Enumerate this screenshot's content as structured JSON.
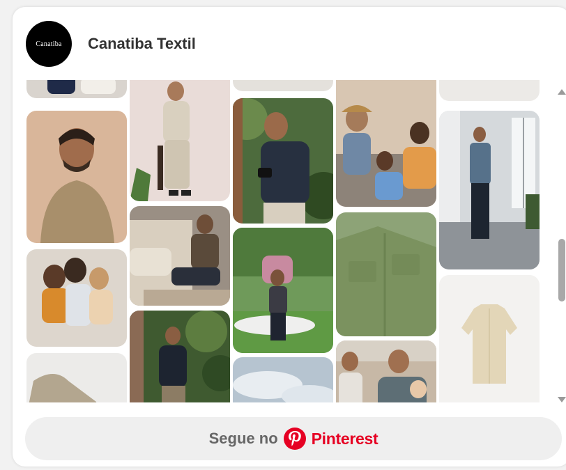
{
  "profile": {
    "name": "Canatiba Textil",
    "avatar_text": "Canatiba"
  },
  "board": {
    "pins": [
      {
        "name": "pin-man-partial-top",
        "bg": "#d9d4ce",
        "fg": "#1f2a48"
      },
      {
        "name": "pin-man-beige-shirt",
        "bg": "#d9b69a",
        "fg": "#a88f6b"
      },
      {
        "name": "pin-family-on-floor",
        "bg": "#ddd6cd",
        "fg": "#d88a2c"
      },
      {
        "name": "pin-shirt-partial",
        "bg": "#ecebe9",
        "fg": "#b3a68f"
      },
      {
        "name": "pin-man-chair-white-outfit",
        "bg": "#e9dcd8",
        "fg": "#d9d0bf"
      },
      {
        "name": "pin-man-on-sofa",
        "bg": "#9a8f84",
        "fg": "#2a2f3a"
      },
      {
        "name": "pin-man-in-forest",
        "bg": "#3f5a30",
        "fg": "#1d2430"
      },
      {
        "name": "pin-top-sliver-col3",
        "bg": "#e4e1dc",
        "fg": "#c9c4bb"
      },
      {
        "name": "pin-man-with-camera",
        "bg": "#4d6b3d",
        "fg": "#273040"
      },
      {
        "name": "pin-man-lifting-child-park",
        "bg": "#6f9a5a",
        "fg": "#3b3b44"
      },
      {
        "name": "pin-sky-partial",
        "bg": "#b6c4d0",
        "fg": "#e8edf1"
      },
      {
        "name": "pin-family-on-sofa",
        "bg": "#d8c6b2",
        "fg": "#6f88a5"
      },
      {
        "name": "pin-green-shirt-folded",
        "bg": "#8da377",
        "fg": "#7b925f"
      },
      {
        "name": "pin-man-with-children",
        "bg": "#c7b8a6",
        "fg": "#5d6e75"
      },
      {
        "name": "pin-top-sliver-col5",
        "bg": "#eceae7",
        "fg": "#d9d6d2"
      },
      {
        "name": "pin-man-loft-standing",
        "bg": "#d5d9dc",
        "fg": "#56718a"
      },
      {
        "name": "pin-cream-shirt-product",
        "bg": "#f3f2f0",
        "fg": "#e3d6b8"
      }
    ]
  },
  "scrollbar": {
    "position_fraction": 0.5
  },
  "follow_button": {
    "label": "Segue no",
    "brand": "Pinterest",
    "brand_color": "#e60023"
  }
}
